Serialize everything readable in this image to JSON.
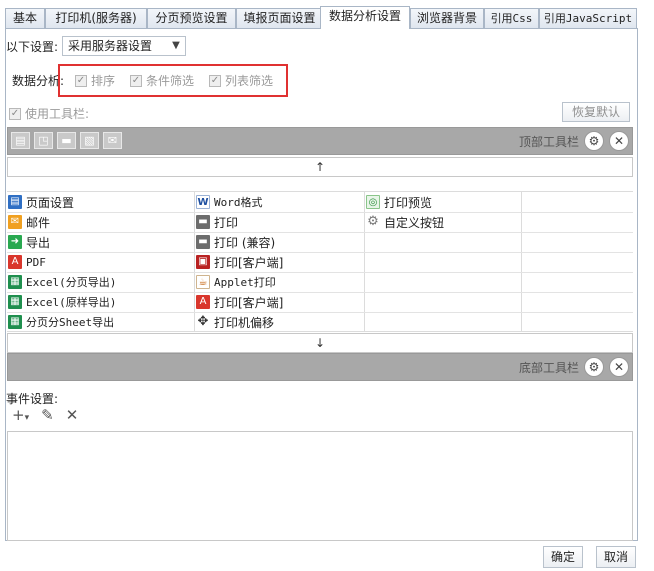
{
  "tabs": [
    {
      "label": "基本",
      "active": false
    },
    {
      "label": "打印机(服务器)",
      "active": false
    },
    {
      "label": "分页预览设置",
      "active": false
    },
    {
      "label": "填报页面设置",
      "active": false
    },
    {
      "label": "数据分析设置",
      "active": true
    },
    {
      "label": "浏览器背景",
      "active": false
    },
    {
      "label": "引用Css",
      "active": false
    },
    {
      "label": "引用JavaScript",
      "active": false
    }
  ],
  "settings": {
    "label": "以下设置:",
    "selected": "采用服务器设置"
  },
  "analysis": {
    "label": "数据分析:",
    "options": [
      {
        "label": "排序",
        "checked": true
      },
      {
        "label": "条件筛选",
        "checked": true
      },
      {
        "label": "列表筛选",
        "checked": true
      }
    ]
  },
  "use_toolbar": {
    "label": "使用工具栏:",
    "checked": true
  },
  "restore_default": "恢复默认",
  "top_toolbar": {
    "title": "顶部工具栏",
    "icons": [
      "page-icon",
      "preview-icon",
      "print-icon",
      "export-icon",
      "mail-icon"
    ]
  },
  "bottom_toolbar": {
    "title": "底部工具栏"
  },
  "arrows": {
    "up": "↑",
    "down": "↓"
  },
  "columns": [
    [
      {
        "label": "页面设置",
        "icon": "page-setup-icon"
      },
      {
        "label": "邮件",
        "icon": "mail-icon"
      },
      {
        "label": "导出",
        "icon": "export-icon"
      },
      {
        "label": "PDF",
        "icon": "pdf-icon"
      },
      {
        "label": "Excel(分页导出)",
        "icon": "excel-icon"
      },
      {
        "label": "Excel(原样导出)",
        "icon": "excel-icon"
      },
      {
        "label": "分页分Sheet导出",
        "icon": "excel-icon"
      }
    ],
    [
      {
        "label": "Word格式",
        "icon": "word-icon"
      },
      {
        "label": "打印",
        "icon": "printer-icon"
      },
      {
        "label": "打印 (兼容)",
        "icon": "printer-icon"
      },
      {
        "label": "打印[客户端]",
        "icon": "print-client-icon"
      },
      {
        "label": "Applet打印",
        "icon": "java-icon"
      },
      {
        "label": "打印[客户端]",
        "icon": "print-pdf-icon"
      },
      {
        "label": "打印机偏移",
        "icon": "move-icon"
      }
    ],
    [
      {
        "label": "打印预览",
        "icon": "print-preview-icon"
      },
      {
        "label": "自定义按钮",
        "icon": "gear-icon"
      }
    ]
  ],
  "events": {
    "label": "事件设置:"
  },
  "footer": {
    "ok": "确定",
    "cancel": "取消"
  }
}
